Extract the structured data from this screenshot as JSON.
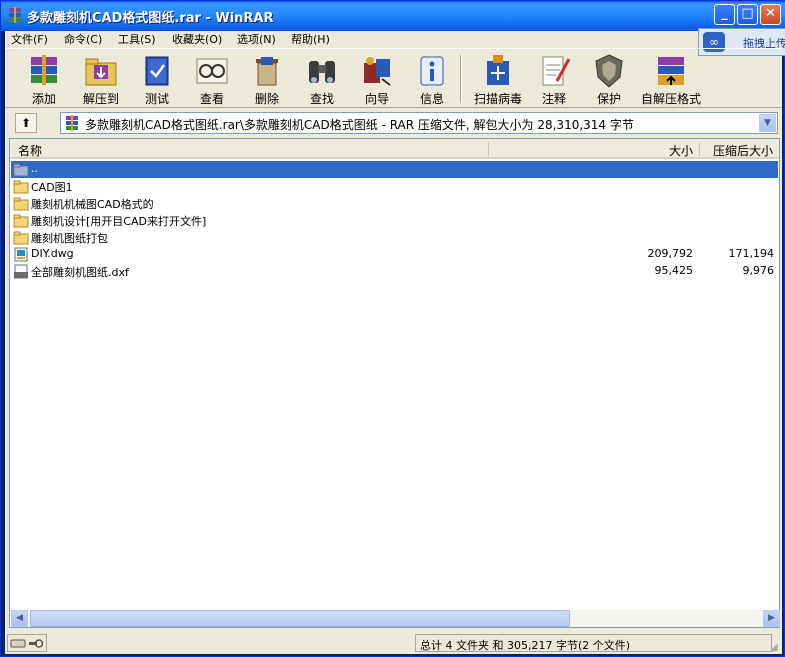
{
  "window": {
    "title": "多款雕刻机CAD格式图纸.rar - WinRAR",
    "minimize": "_",
    "maximize": "□",
    "close": "✕"
  },
  "menu": [
    {
      "label": "文件(F)"
    },
    {
      "label": "命令(C)"
    },
    {
      "label": "工具(S)"
    },
    {
      "label": "收藏夹(O)"
    },
    {
      "label": "选项(N)"
    },
    {
      "label": "帮助(H)"
    }
  ],
  "upload": {
    "label": "拖拽上传",
    "icon": "cloud-link-icon"
  },
  "toolbar": [
    {
      "label": "添加",
      "icon": "add-books-icon",
      "color": "#8b3fa0"
    },
    {
      "label": "解压到",
      "icon": "extract-folder-icon",
      "color": "#d9a12a"
    },
    {
      "label": "测试",
      "icon": "test-book-icon",
      "color": "#2a4fae"
    },
    {
      "label": "查看",
      "icon": "view-glasses-icon",
      "color": "#d6d2c8"
    },
    {
      "label": "删除",
      "icon": "delete-recycle-icon",
      "color": "#7a4a2a"
    },
    {
      "label": "查找",
      "icon": "find-binoculars-icon",
      "color": "#3c3c3c"
    },
    {
      "label": "向导",
      "icon": "wizard-icon",
      "color": "#8e2a2a"
    },
    {
      "label": "信息",
      "icon": "info-icon",
      "color": "#2a5ab8"
    },
    {
      "label": "扫描病毒",
      "icon": "scan-virus-icon",
      "color": "#d68a1a"
    },
    {
      "label": "注释",
      "icon": "comment-icon",
      "color": "#e8e4d8"
    },
    {
      "label": "保护",
      "icon": "protect-shield-icon",
      "color": "#6a6a5a"
    },
    {
      "label": "自解压格式",
      "icon": "sfx-icon",
      "color": "#a83030"
    }
  ],
  "address": {
    "path": "多款雕刻机CAD格式图纸.rar\\多款雕刻机CAD格式图纸 - RAR 压缩文件, 解包大小为 28,310,314 字节"
  },
  "columns": {
    "name": "名称",
    "size": "大小",
    "packed": "压缩后大小"
  },
  "files": [
    {
      "name": "..",
      "type": "parent",
      "size": "",
      "packed": "",
      "selected": true
    },
    {
      "name": "CAD图1",
      "type": "folder",
      "size": "",
      "packed": ""
    },
    {
      "name": "雕刻机机械图CAD格式的",
      "type": "folder",
      "size": "",
      "packed": ""
    },
    {
      "name": "雕刻机设计[用开目CAD来打开文件]",
      "type": "folder",
      "size": "",
      "packed": ""
    },
    {
      "name": "雕刻机图纸打包",
      "type": "folder",
      "size": "",
      "packed": ""
    },
    {
      "name": "DIY.dwg",
      "type": "dwg",
      "size": "209,792",
      "packed": "171,194"
    },
    {
      "name": "全部雕刻机图纸.dxf",
      "type": "dxf",
      "size": "95,425",
      "packed": "9,976"
    }
  ],
  "status": {
    "text": "总计 4 文件夹 和 305,217 字节(2 个文件)"
  },
  "colors": {
    "selection": "#316ac5",
    "titlebar": "#0f61e8",
    "chrome": "#ece9d8"
  }
}
